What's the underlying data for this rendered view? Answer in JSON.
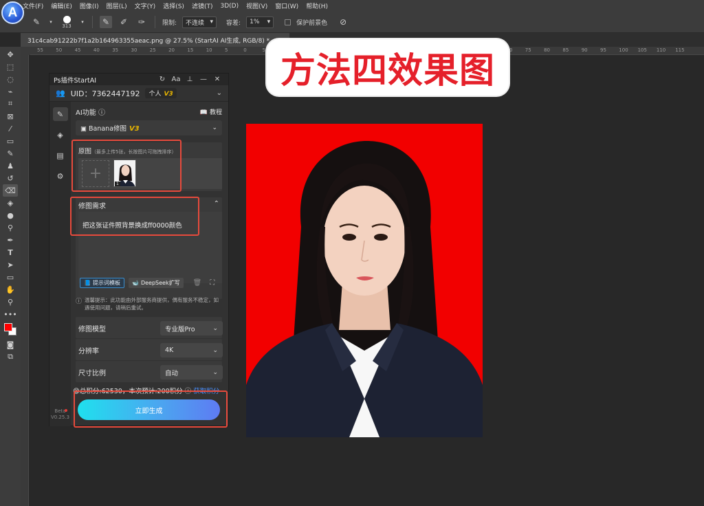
{
  "menubar": {
    "items": [
      "文件(F)",
      "编辑(E)",
      "图像(I)",
      "图层(L)",
      "文字(Y)",
      "选择(S)",
      "滤镜(T)",
      "3D(D)",
      "视图(V)",
      "窗口(W)",
      "帮助(H)"
    ]
  },
  "logo": {
    "letter": "A"
  },
  "options": {
    "brush_size": "313",
    "limit_label": "限制:",
    "limit_value": "不连续",
    "tolerance_label": "容差:",
    "tolerance_value": "1%",
    "protect_fg_label": "保护前景色"
  },
  "document_tab": {
    "title": "31c4cab91222b7f1a2b164963355aeac.png @ 27.5% (StartAI AI生成, RGB/8) *",
    "close": "×"
  },
  "ruler_ticks": [
    "55",
    "50",
    "45",
    "40",
    "35",
    "30",
    "25",
    "20",
    "15",
    "10",
    "5",
    "0",
    "5",
    "10",
    "15",
    "20",
    "25",
    "30",
    "35",
    "40",
    "45",
    "50",
    "55",
    "60",
    "65",
    "70",
    "75",
    "80",
    "85",
    "90",
    "95",
    "100",
    "105",
    "110",
    "115"
  ],
  "banner": {
    "text": "方法四效果图"
  },
  "panel": {
    "title": "Ps插件StartAI",
    "uid": "UID：7362447192",
    "plan": "个人",
    "plan_version": "V3",
    "ai_function_label": "AI功能 ⓘ",
    "tutorial_label": "教程",
    "model_select": "Banana修图",
    "model_version": "V3",
    "original_label": "原图",
    "original_hint": "（最多上传5张，长按图片可拖拽排序）",
    "thumb_index": "1",
    "requirement_label": "修图需求",
    "requirement_text": "把这张证件照背景换成ff0000颜色",
    "prompt_template_btn": "提示词模板",
    "deepseek_btn": "DeepSeek扩写",
    "notice": "温馨提示：此功能由外部服务商提供，偶有服务不稳定，如遇使用问题，请稍后重试。",
    "model_label": "修图模型",
    "model_value": "专业版Pro",
    "resolution_label": "分辨率",
    "resolution_value": "4K",
    "ratio_label": "尺寸比例",
    "ratio_value": "自动",
    "points_text": "😊总积分:62530，本次预计:200积分 ⓘ",
    "points_link": "获取积分",
    "generate_btn": "立即生成",
    "beta": "Beta",
    "version": "V0.25.3"
  },
  "colors": {
    "accent_red": "#e84a3c",
    "photo_bg": "#f20000",
    "banner_text": "#e5202a",
    "gen_start": "#1fe0ee",
    "gen_end": "#5e7bf2",
    "version_gold": "#e8b500"
  }
}
